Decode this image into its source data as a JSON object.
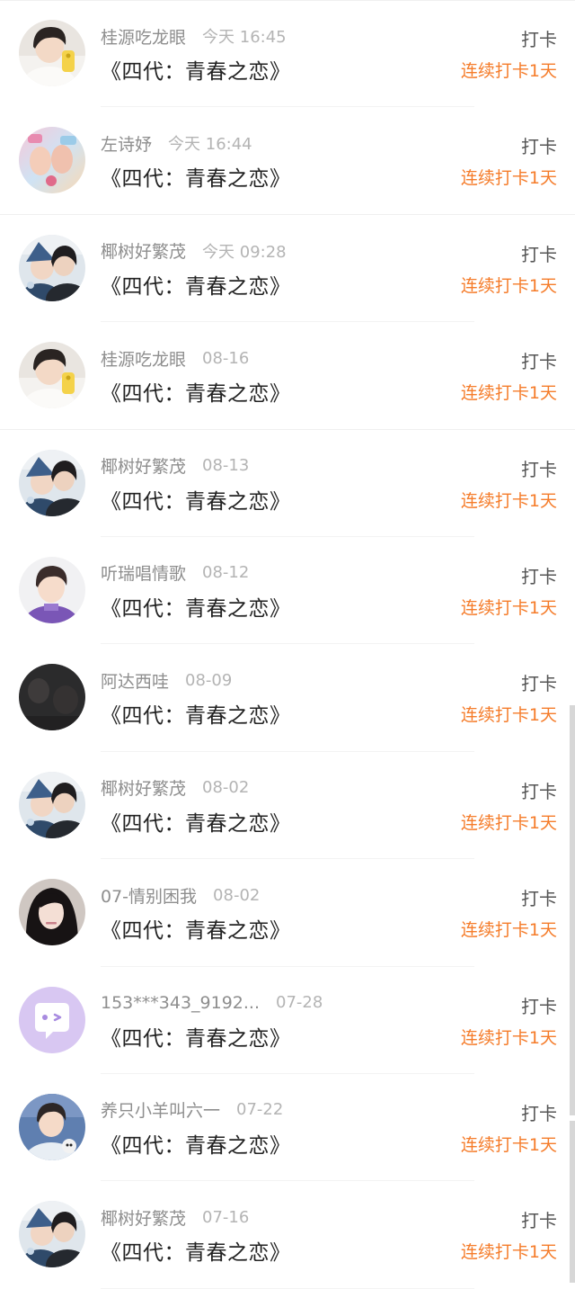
{
  "streak_color": "#f57c2a",
  "items": [
    {
      "name": "桂源吃龙眼",
      "time": "今天 16:45",
      "title": "《四代：青春之恋》",
      "action": "打卡",
      "streak": "连续打卡1天",
      "avatar": "boy-selfie"
    },
    {
      "name": "左诗妤",
      "time": "今天 16:44",
      "title": "《四代：青春之恋》",
      "action": "打卡",
      "streak": "连续打卡1天",
      "avatar": "pastel-hands"
    },
    {
      "name": "椰树好繁茂",
      "time": "今天 09:28",
      "title": "《四代：青春之恋》",
      "action": "打卡",
      "streak": "连续打卡1天",
      "avatar": "couple"
    },
    {
      "name": "桂源吃龙眼",
      "time": "08-16",
      "title": "《四代：青春之恋》",
      "action": "打卡",
      "streak": "连续打卡1天",
      "avatar": "boy-selfie"
    },
    {
      "name": "椰树好繁茂",
      "time": "08-13",
      "title": "《四代：青春之恋》",
      "action": "打卡",
      "streak": "连续打卡1天",
      "avatar": "couple"
    },
    {
      "name": "听瑞唱情歌",
      "time": "08-12",
      "title": "《四代：青春之恋》",
      "action": "打卡",
      "streak": "连续打卡1天",
      "avatar": "boy-purple"
    },
    {
      "name": "阿达西哇",
      "time": "08-09",
      "title": "《四代：青春之恋》",
      "action": "打卡",
      "streak": "连续打卡1天",
      "avatar": "dark"
    },
    {
      "name": "椰树好繁茂",
      "time": "08-02",
      "title": "《四代：青春之恋》",
      "action": "打卡",
      "streak": "连续打卡1天",
      "avatar": "couple"
    },
    {
      "name": "07-情别困我",
      "time": "08-02",
      "title": "《四代：青春之恋》",
      "action": "打卡",
      "streak": "连续打卡1天",
      "avatar": "girl-dark-hair"
    },
    {
      "name": "153***343_9192...",
      "time": "07-28",
      "title": "《四代：青春之恋》",
      "action": "打卡",
      "streak": "连续打卡1天",
      "avatar": "default-chat"
    },
    {
      "name": "养只小羊叫六一",
      "time": "07-22",
      "title": "《四代：青春之恋》",
      "action": "打卡",
      "streak": "连续打卡1天",
      "avatar": "boy-cat"
    },
    {
      "name": "椰树好繁茂",
      "time": "07-16",
      "title": "《四代：青春之恋》",
      "action": "打卡",
      "streak": "连续打卡1天",
      "avatar": "couple"
    }
  ]
}
